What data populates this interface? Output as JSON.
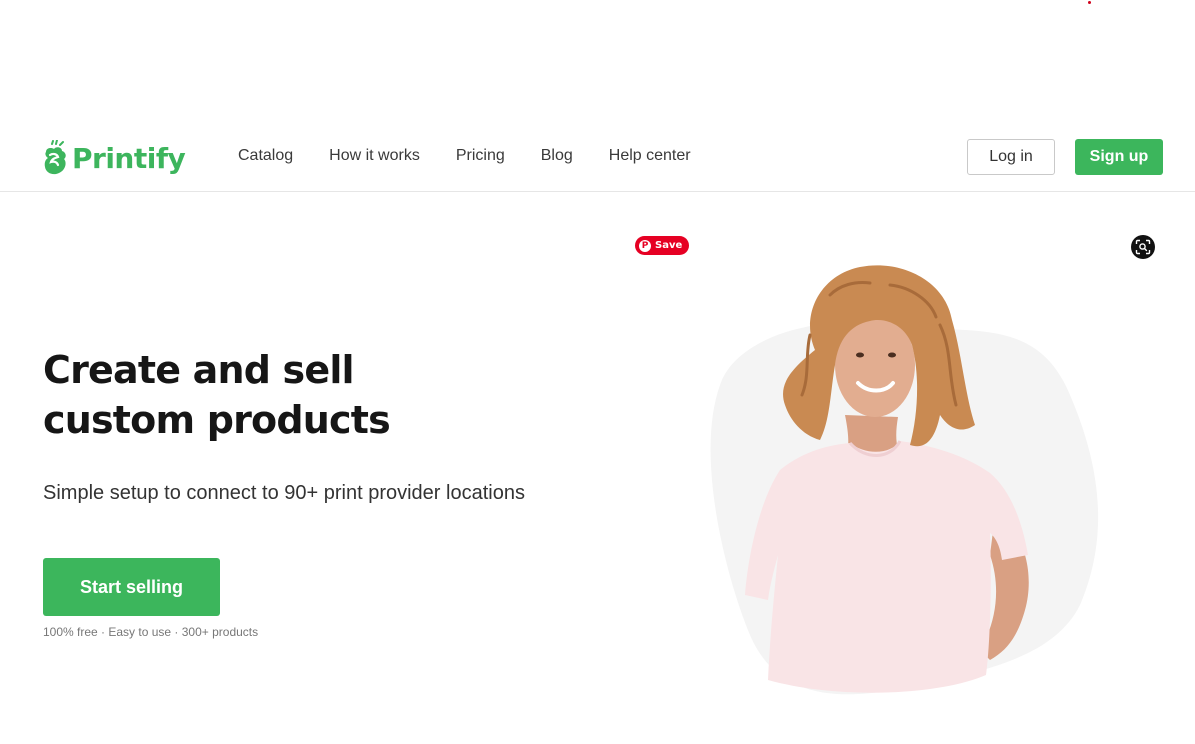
{
  "brand": {
    "name": "Printify",
    "accent_color": "#3cb65c"
  },
  "nav": {
    "items": [
      {
        "label": "Catalog"
      },
      {
        "label": "How it works"
      },
      {
        "label": "Pricing"
      },
      {
        "label": "Blog"
      },
      {
        "label": "Help center"
      }
    ]
  },
  "auth": {
    "login_label": "Log in",
    "signup_label": "Sign up"
  },
  "hero": {
    "title_line1": "Create and sell",
    "title_line2": "custom products",
    "subtitle": "Simple setup to connect to 90+ print provider locations",
    "cta_label": "Start selling",
    "features": "100% free · Easy to use  · 300+ products"
  },
  "overlays": {
    "pinterest_save_label": "Save",
    "pinterest_color": "#e60023",
    "lens_icon": "visual-search-icon"
  }
}
